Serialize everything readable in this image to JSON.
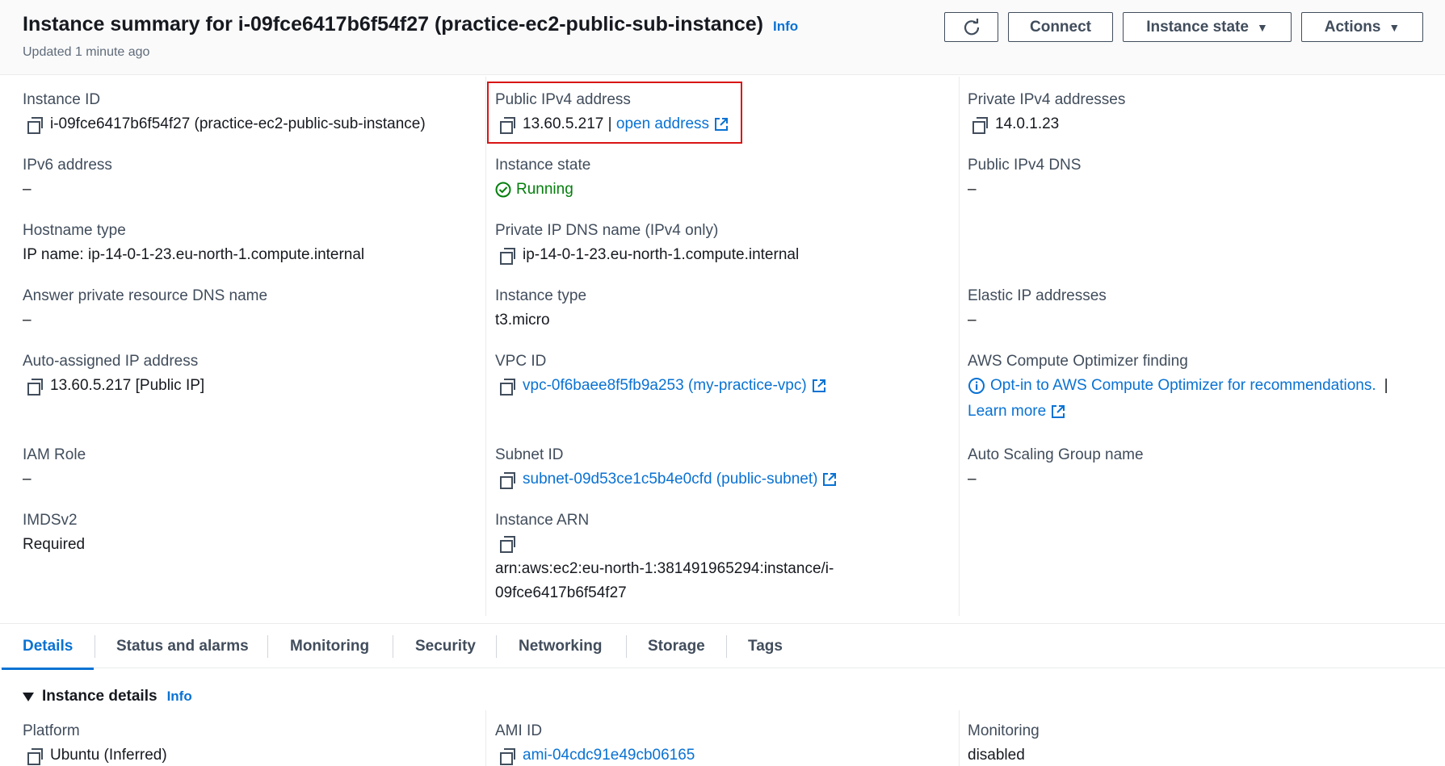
{
  "header": {
    "title": "Instance summary for i-09fce6417b6f54f27 (practice-ec2-public-sub-instance)",
    "info": "Info",
    "subtitle": "Updated 1 minute ago",
    "connect": "Connect",
    "instance_state": "Instance state",
    "actions": "Actions"
  },
  "fields": {
    "instance_id": {
      "label": "Instance ID",
      "value": "i-09fce6417b6f54f27 (practice-ec2-public-sub-instance)"
    },
    "public_ipv4": {
      "label": "Public IPv4 address",
      "value": "13.60.5.217 |",
      "link": "open address"
    },
    "private_ipv4": {
      "label": "Private IPv4 addresses",
      "value": "14.0.1.23"
    },
    "ipv6": {
      "label": "IPv6 address",
      "value": "–"
    },
    "instance_state": {
      "label": "Instance state",
      "value": "Running"
    },
    "public_dns": {
      "label": "Public IPv4 DNS",
      "value": "–"
    },
    "hostname_type": {
      "label": "Hostname type",
      "value": "IP name: ip-14-0-1-23.eu-north-1.compute.internal"
    },
    "private_dns": {
      "label": "Private IP DNS name (IPv4 only)",
      "value": "ip-14-0-1-23.eu-north-1.compute.internal"
    },
    "answer_dns": {
      "label": "Answer private resource DNS name",
      "value": "–"
    },
    "instance_type": {
      "label": "Instance type",
      "value": "t3.micro"
    },
    "elastic_ip": {
      "label": "Elastic IP addresses",
      "value": "–"
    },
    "auto_ip": {
      "label": "Auto-assigned IP address",
      "value": "13.60.5.217 [Public IP]"
    },
    "vpc_id": {
      "label": "VPC ID",
      "value": "vpc-0f6baee8f5fb9a253 (my-practice-vpc)"
    },
    "optimizer": {
      "label": "AWS Compute Optimizer finding",
      "value": "Opt-in to AWS Compute Optimizer for recommendations.",
      "sep": "|",
      "learn": "Learn more"
    },
    "iam_role": {
      "label": "IAM Role",
      "value": "–"
    },
    "subnet_id": {
      "label": "Subnet ID",
      "value": "subnet-09d53ce1c5b4e0cfd (public-subnet)"
    },
    "asg_name": {
      "label": "Auto Scaling Group name",
      "value": "–"
    },
    "imdsv2": {
      "label": "IMDSv2",
      "value": "Required"
    },
    "arn": {
      "label": "Instance ARN",
      "line1": "arn:aws:ec2:eu-north-1:381491965294:instance/i-",
      "line2": "09fce6417b6f54f27"
    }
  },
  "tabs": [
    "Details",
    "Status and alarms",
    "Monitoring",
    "Security",
    "Networking",
    "Storage",
    "Tags"
  ],
  "details_section": {
    "title": "Instance details",
    "info": "Info",
    "platform": {
      "label": "Platform",
      "value": "Ubuntu (Inferred)"
    },
    "ami_id": {
      "label": "AMI ID",
      "value": "ami-04cdc91e49cb06165"
    },
    "monitoring": {
      "label": "Monitoring",
      "value": "disabled"
    }
  },
  "colors": {
    "accent": "#0972d3",
    "running": "#037f0c",
    "highlight": "#d91515"
  }
}
